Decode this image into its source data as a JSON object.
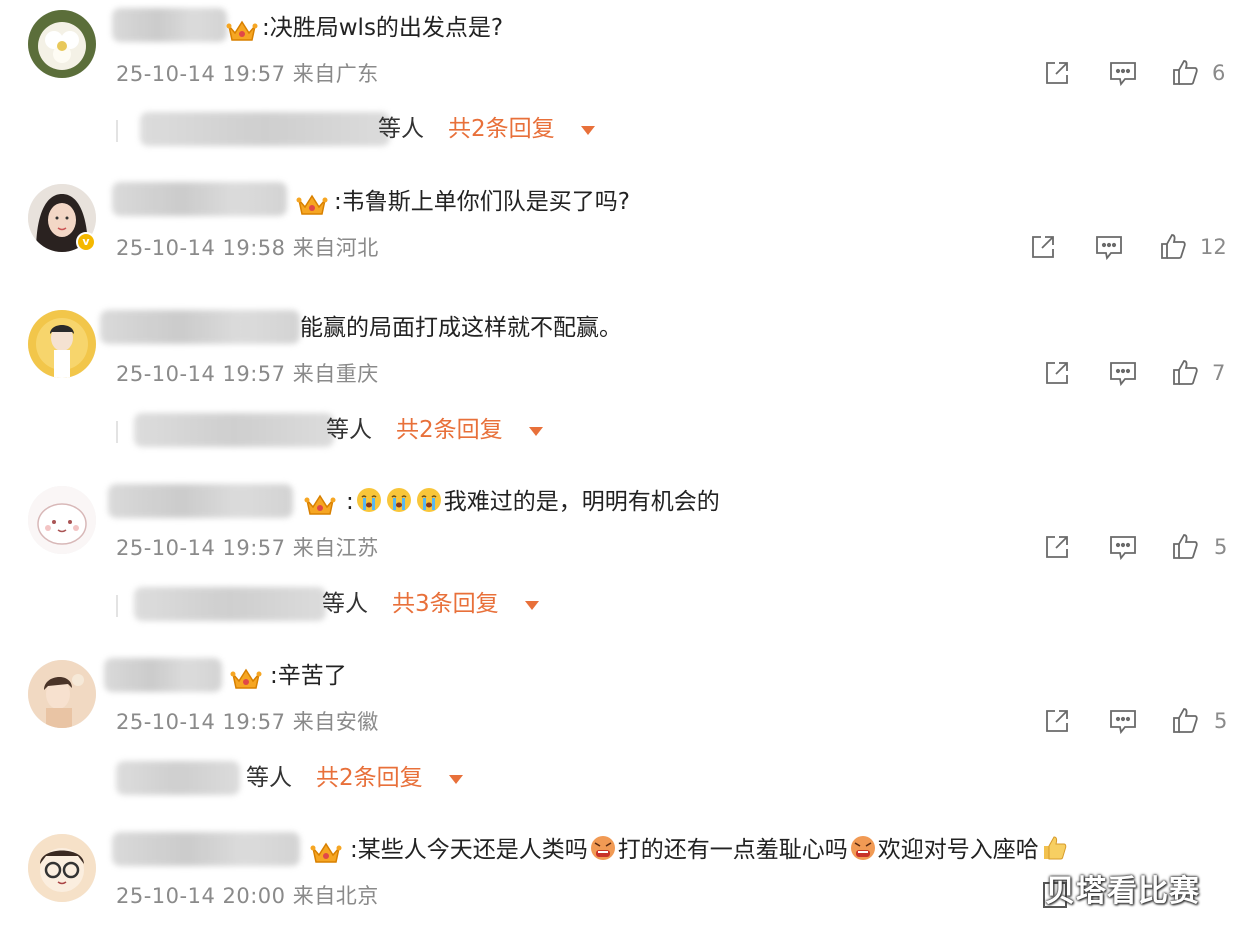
{
  "colors": {
    "accent": "#e8703a",
    "meta": "#8a8a8a",
    "text": "#222222"
  },
  "comments": [
    {
      "text": ":决胜局wls的出发点是?",
      "meta": "25-10-14 19:57 来自广东",
      "likes": "6",
      "reply": {
        "deng": "等人",
        "count": "共2条回复"
      }
    },
    {
      "text": ":韦鲁斯上单你们队是买了吗?",
      "meta": "25-10-14 19:58 来自河北",
      "likes": "12"
    },
    {
      "text": "能赢的局面打成这样就不配赢。",
      "meta": "25-10-14 19:57 来自重庆",
      "likes": "7",
      "reply": {
        "deng": "等人",
        "count": "共2条回复"
      }
    },
    {
      "text_prefix": ":",
      "text": "我难过的是，明明有机会的",
      "meta": "25-10-14 19:57 来自江苏",
      "likes": "5",
      "reply": {
        "deng": "等人",
        "count": "共3条回复"
      }
    },
    {
      "text": ":辛苦了",
      "meta": "25-10-14 19:57 来自安徽",
      "likes": "5",
      "reply": {
        "deng": "等人",
        "count": "共2条回复"
      }
    },
    {
      "text_a": ":某些人今天还是人类吗",
      "text_b": "打的还有一点羞耻心吗",
      "text_c": "欢迎对号入座哈",
      "meta": "25-10-14 20:00 来自北京"
    }
  ],
  "icons": {
    "share": "share-icon",
    "comment": "comment-icon",
    "like": "thumbs-up-icon",
    "crown": "crown-badge-icon",
    "crying": "crying-emoji-icon",
    "angry": "angry-emoji-icon",
    "thumb": "thumbs-up-emoji-icon"
  },
  "watermark": "贝塔看比赛"
}
